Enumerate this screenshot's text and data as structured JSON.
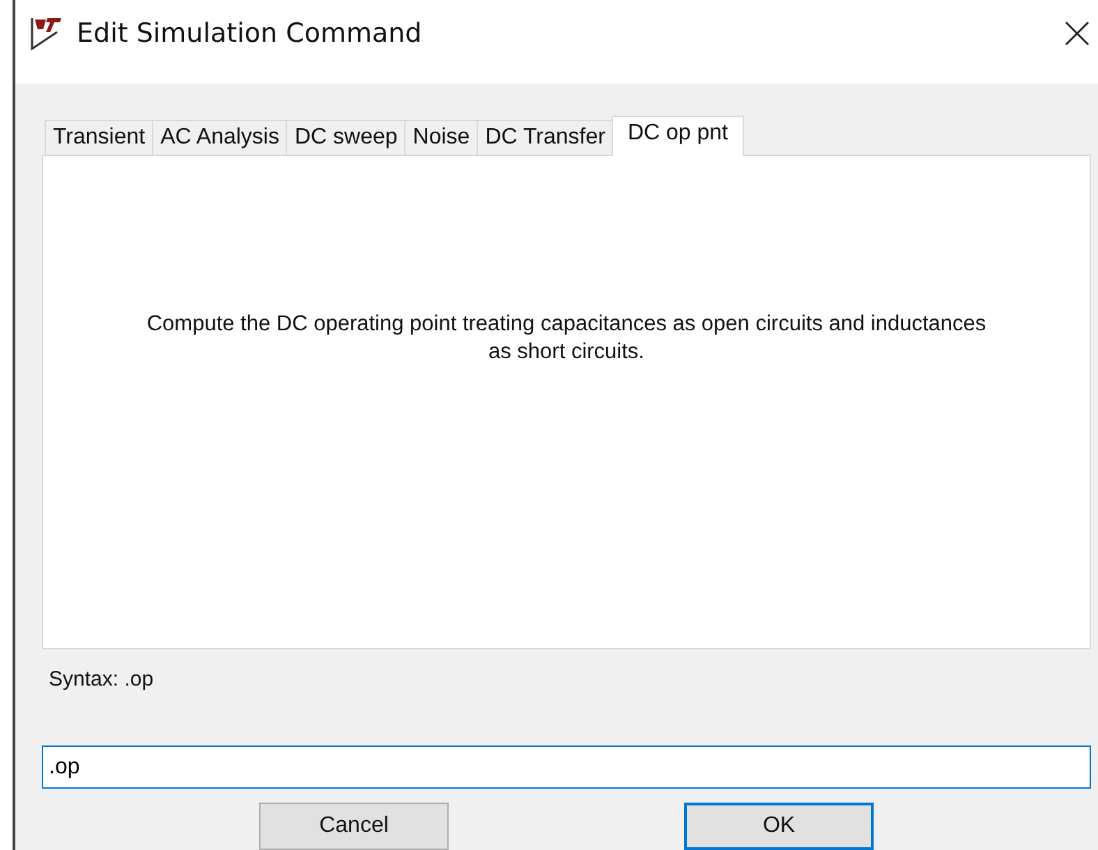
{
  "window": {
    "title": "Edit Simulation Command"
  },
  "tabs": [
    {
      "label": "Transient",
      "selected": false
    },
    {
      "label": "AC Analysis",
      "selected": false
    },
    {
      "label": "DC sweep",
      "selected": false
    },
    {
      "label": "Noise",
      "selected": false
    },
    {
      "label": "DC Transfer",
      "selected": false
    },
    {
      "label": "DC op pnt",
      "selected": true
    }
  ],
  "description": "Compute the DC operating point treating capacitances as open circuits and inductances as short circuits.",
  "syntax": "Syntax: .op",
  "command": {
    "value": ".op"
  },
  "buttons": [
    {
      "label": "Cancel",
      "default": false
    },
    {
      "label": "OK",
      "default": true
    }
  ]
}
